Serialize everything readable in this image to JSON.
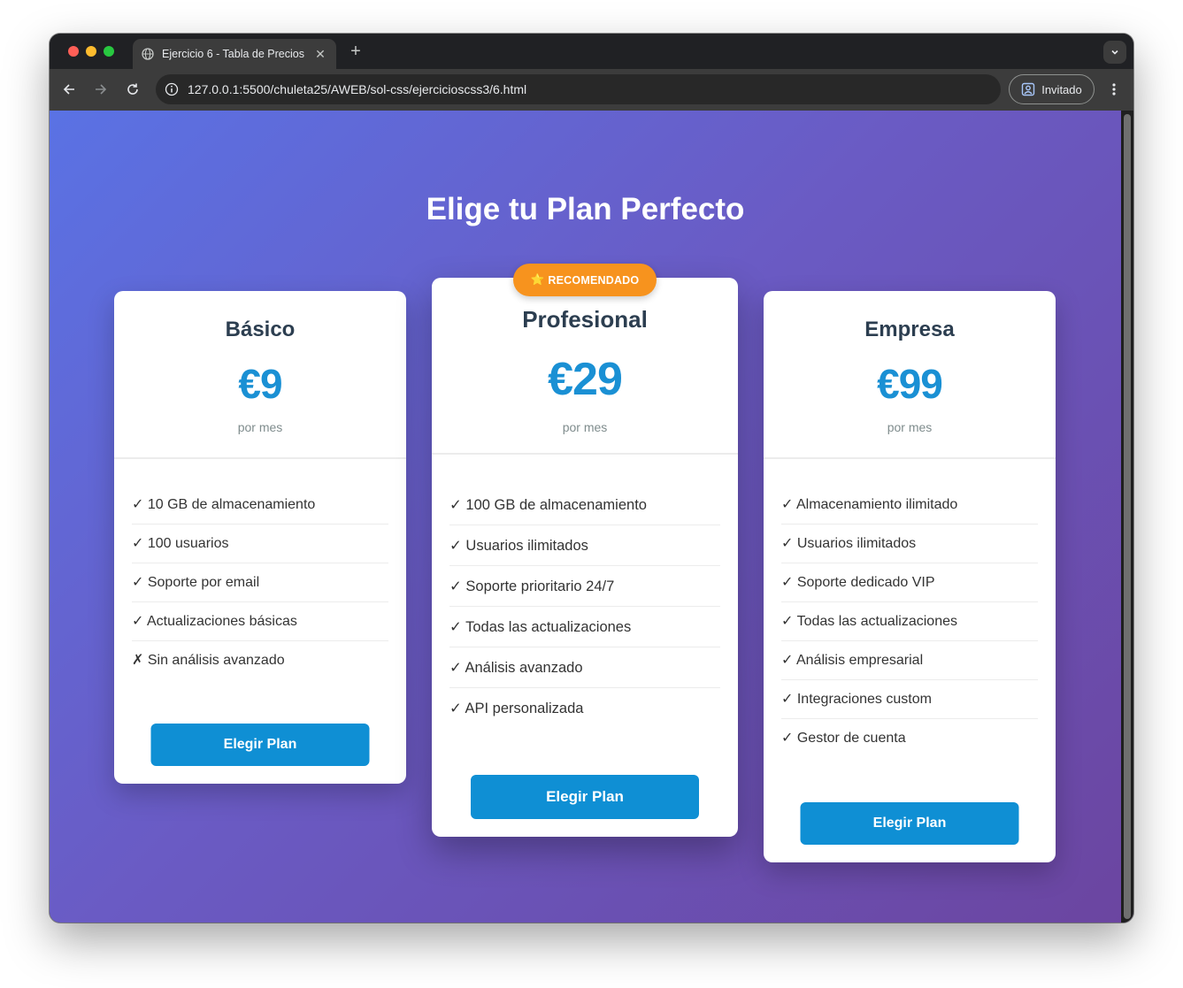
{
  "browser": {
    "tab_title": "Ejercicio 6 - Tabla de Precios",
    "tab_close": "✕",
    "new_tab": "+",
    "url": "127.0.0.1:5500/chuleta25/AWEB/sol-css/ejercicioscss3/6.html",
    "profile_label": "Invitado"
  },
  "page": {
    "title": "Elige tu Plan Perfecto"
  },
  "plans": [
    {
      "name": "Básico",
      "price": "€9",
      "period": "por mes",
      "features": [
        "✓ 10 GB de almacenamiento",
        "✓ 100 usuarios",
        "✓ Soporte por email",
        "✓ Actualizaciones básicas",
        "✗ Sin análisis avanzado"
      ],
      "button": "Elegir Plan"
    },
    {
      "badge_icon": "⭐",
      "badge": "RECOMENDADO",
      "name": "Profesional",
      "price": "€29",
      "period": "por mes",
      "features": [
        "✓ 100 GB de almacenamiento",
        "✓ Usuarios ilimitados",
        "✓ Soporte prioritario 24/7",
        "✓ Todas las actualizaciones",
        "✓ Análisis avanzado",
        "✓ API personalizada"
      ],
      "button": "Elegir Plan"
    },
    {
      "name": "Empresa",
      "price": "€99",
      "period": "por mes",
      "features": [
        "✓ Almacenamiento ilimitado",
        "✓ Usuarios ilimitados",
        "✓ Soporte dedicado VIP",
        "✓ Todas las actualizaciones",
        "✓ Análisis empresarial",
        "✓ Integraciones custom",
        "✓ Gestor de cuenta"
      ],
      "button": "Elegir Plan"
    }
  ],
  "colors": {
    "accent": "#0f8fd4",
    "price": "#1a90d4",
    "badge": "#f7931e",
    "gradient_start": "#5a72e4",
    "gradient_end": "#6b45a0"
  }
}
